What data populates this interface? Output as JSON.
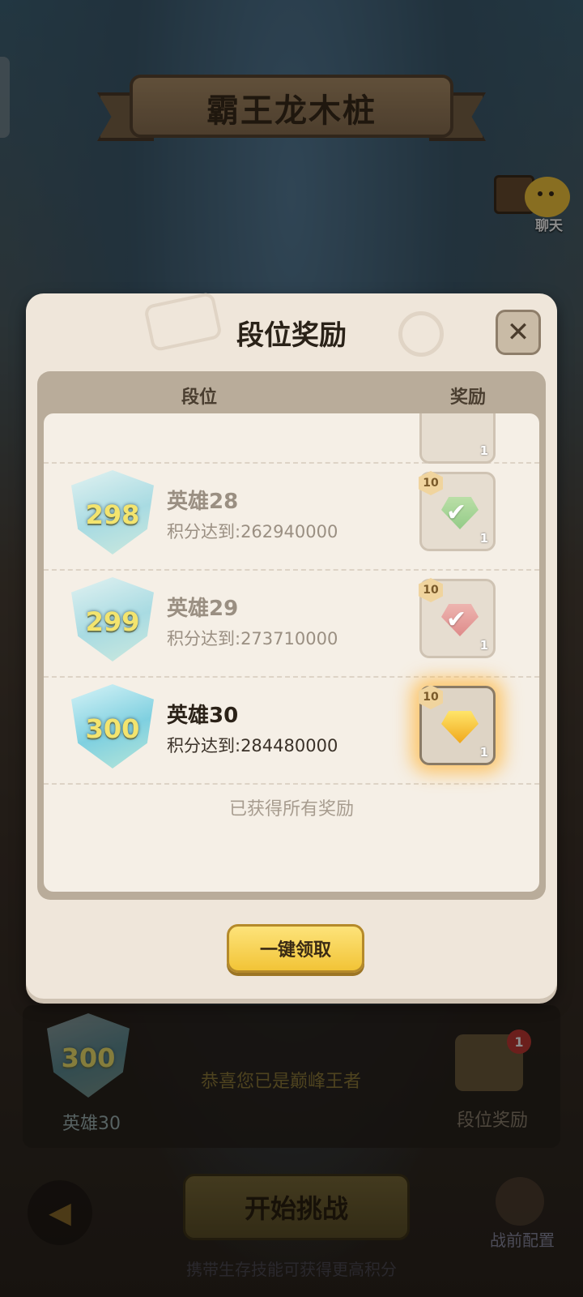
{
  "header": {
    "stage_title": "霸王龙木桩",
    "chat_label": "聊天"
  },
  "dialog": {
    "title": "段位奖励",
    "close_icon": "close-icon",
    "columns": {
      "rank": "段位",
      "reward": "奖励"
    },
    "rows": [
      {
        "badge_number": "298",
        "name": "英雄28",
        "score": "积分达到:262940000",
        "reward_level": "10",
        "reward_count": "1",
        "reward_color": "green",
        "claimed": true
      },
      {
        "badge_number": "299",
        "name": "英雄29",
        "score": "积分达到:273710000",
        "reward_level": "10",
        "reward_count": "1",
        "reward_color": "red",
        "claimed": true
      },
      {
        "badge_number": "300",
        "name": "英雄30",
        "score": "积分达到:284480000",
        "reward_level": "10",
        "reward_count": "1",
        "reward_color": "gold",
        "claimed": false
      }
    ],
    "partial_row_count": "1",
    "all_obtained_text": "已获得所有奖励",
    "claim_all_label": "一键领取"
  },
  "lower_panel": {
    "current_badge_number": "300",
    "current_rank_label": "英雄30",
    "congrats_text": "恭喜您已是巅峰王者",
    "rank_reward_label": "段位奖励",
    "rank_reward_badge": "1"
  },
  "footer": {
    "start_label": "开始挑战",
    "tip_text": "携带生存技能可获得更高积分",
    "prebattle_label": "战前配置"
  }
}
